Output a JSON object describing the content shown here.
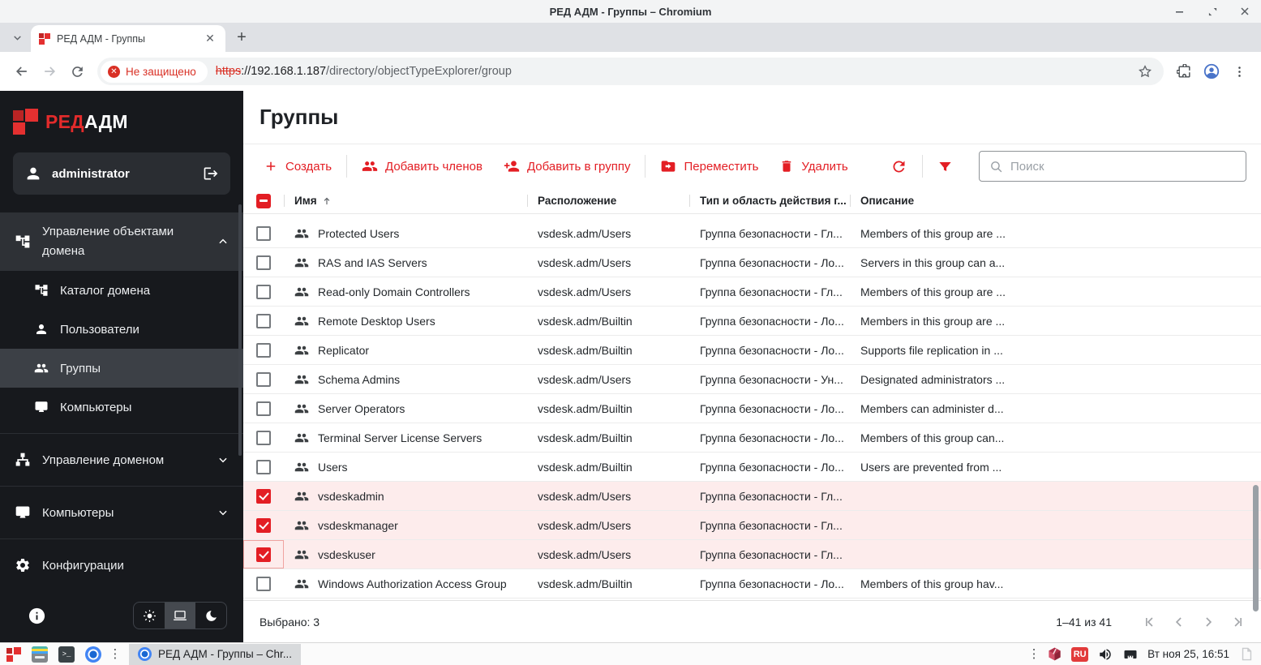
{
  "colors": {
    "accent": "#e31e24",
    "chrome_red": "#d93025",
    "selected_row": "#fdecec"
  },
  "window": {
    "title": "РЕД АДМ - Группы – Chromium"
  },
  "browser": {
    "tab_title": "РЕД АДМ - Группы",
    "security_badge": "Не защищено",
    "url_scheme": "https",
    "url_host": "://192.168.1.187",
    "url_path": "/directory/objectTypeExplorer/group"
  },
  "sidebar": {
    "logo_red": "РЕД",
    "logo_white": "АДМ",
    "username": "administrator",
    "menu": {
      "domain_objects": "Управление объектами домена",
      "domain_catalog": "Каталог домена",
      "users": "Пользователи",
      "groups": "Группы",
      "computers_sub": "Компьютеры",
      "domain_management": "Управление доменом",
      "computers": "Компьютеры",
      "configurations": "Конфигурации"
    }
  },
  "page": {
    "title": "Группы",
    "toolbar": {
      "create": "Создать",
      "add_members": "Добавить членов",
      "add_to_group": "Добавить в группу",
      "move": "Переместить",
      "delete": "Удалить",
      "search_placeholder": "Поиск"
    },
    "table": {
      "columns": {
        "name": "Имя",
        "location": "Расположение",
        "type": "Тип и область действия г...",
        "description": "Описание"
      },
      "rows": [
        {
          "name": "Protected Users",
          "location": "vsdesk.adm/Users",
          "type": "Группа безопасности - Гл...",
          "description": "Members of this group are ...",
          "checked": false,
          "selected": false,
          "focused": false
        },
        {
          "name": "RAS and IAS Servers",
          "location": "vsdesk.adm/Users",
          "type": "Группа безопасности - Ло...",
          "description": "Servers in this group can a...",
          "checked": false,
          "selected": false,
          "focused": false
        },
        {
          "name": "Read-only Domain Controllers",
          "location": "vsdesk.adm/Users",
          "type": "Группа безопасности - Гл...",
          "description": "Members of this group are ...",
          "checked": false,
          "selected": false,
          "focused": false
        },
        {
          "name": "Remote Desktop Users",
          "location": "vsdesk.adm/Builtin",
          "type": "Группа безопасности - Ло...",
          "description": "Members in this group are ...",
          "checked": false,
          "selected": false,
          "focused": false
        },
        {
          "name": "Replicator",
          "location": "vsdesk.adm/Builtin",
          "type": "Группа безопасности - Ло...",
          "description": "Supports file replication in ...",
          "checked": false,
          "selected": false,
          "focused": false
        },
        {
          "name": "Schema Admins",
          "location": "vsdesk.adm/Users",
          "type": "Группа безопасности - Ун...",
          "description": "Designated administrators ...",
          "checked": false,
          "selected": false,
          "focused": false
        },
        {
          "name": "Server Operators",
          "location": "vsdesk.adm/Builtin",
          "type": "Группа безопасности - Ло...",
          "description": "Members can administer d...",
          "checked": false,
          "selected": false,
          "focused": false
        },
        {
          "name": "Terminal Server License Servers",
          "location": "vsdesk.adm/Builtin",
          "type": "Группа безопасности - Ло...",
          "description": "Members of this group can...",
          "checked": false,
          "selected": false,
          "focused": false
        },
        {
          "name": "Users",
          "location": "vsdesk.adm/Builtin",
          "type": "Группа безопасности - Ло...",
          "description": "Users are prevented from ...",
          "checked": false,
          "selected": false,
          "focused": false
        },
        {
          "name": "vsdeskadmin",
          "location": "vsdesk.adm/Users",
          "type": "Группа безопасности - Гл...",
          "description": "",
          "checked": true,
          "selected": true,
          "focused": false
        },
        {
          "name": "vsdeskmanager",
          "location": "vsdesk.adm/Users",
          "type": "Группа безопасности - Гл...",
          "description": "",
          "checked": true,
          "selected": true,
          "focused": false
        },
        {
          "name": "vsdeskuser",
          "location": "vsdesk.adm/Users",
          "type": "Группа безопасности - Гл...",
          "description": "",
          "checked": true,
          "selected": true,
          "focused": true
        },
        {
          "name": "Windows Authorization Access Group",
          "location": "vsdesk.adm/Builtin",
          "type": "Группа безопасности - Ло...",
          "description": "Members of this group hav...",
          "checked": false,
          "selected": false,
          "focused": false
        }
      ]
    },
    "footer": {
      "selected": "Выбрано: 3",
      "range": "1–41 из 41"
    }
  },
  "taskbar": {
    "active_task": "РЕД АДМ - Группы – Chr...",
    "layout": "RU",
    "clock": "Вт ноя 25, 16:51"
  }
}
